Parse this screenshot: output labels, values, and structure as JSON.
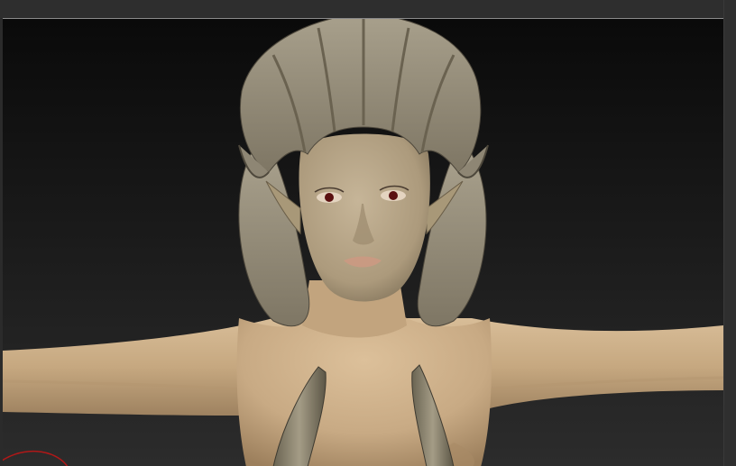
{
  "app": {
    "background_color": "#2b2b2b",
    "viewport_gradient_top": "#0b0b0b",
    "viewport_gradient_bottom": "#2d2d2d"
  },
  "viewport": {
    "model": "elf-girl-sculpt",
    "material": "skin-shaded",
    "colors": {
      "skin": "#cdb08c",
      "skin_shadow": "#a88a66",
      "hair": "#9a9280",
      "hair_shadow": "#5e584a",
      "face": "#b8a78a",
      "eye": "#5a1010",
      "lips": "#c99a82"
    }
  },
  "overlays": {
    "brush_cursor_color": "#b01818"
  }
}
